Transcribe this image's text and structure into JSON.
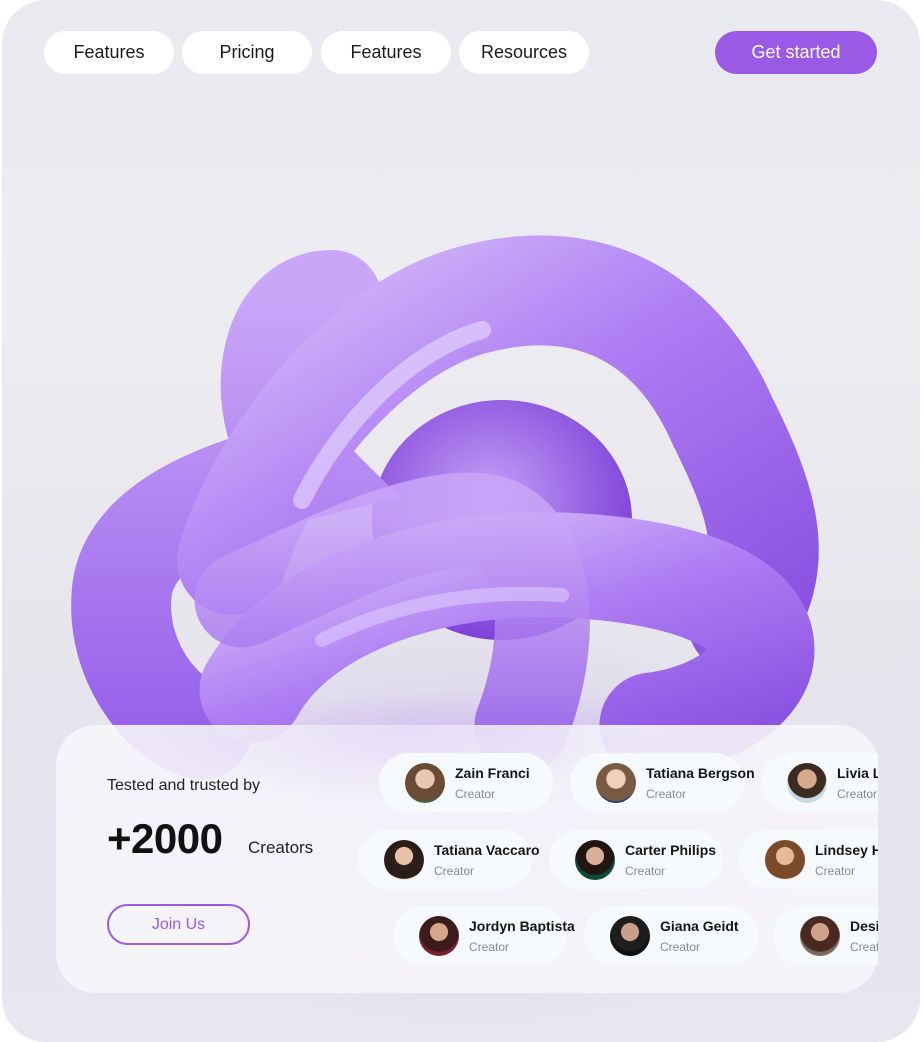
{
  "nav": {
    "items": [
      {
        "label": "Features"
      },
      {
        "label": "Pricing"
      },
      {
        "label": "Features"
      },
      {
        "label": "Resources"
      }
    ],
    "cta_label": "Get started"
  },
  "hero": {
    "tested_text": "Tested and trusted by",
    "count": "+2000",
    "count_suffix": "Creators",
    "join_label": "Join Us"
  },
  "creators": {
    "rows": [
      [
        {
          "name": "Zain Franci",
          "role": "Creator"
        },
        {
          "name": "Tatiana Bergson",
          "role": "Creator"
        },
        {
          "name": "Livia Lipshutz",
          "role": "Creator"
        }
      ],
      [
        {
          "name": "Tatiana Vaccaro",
          "role": "Creator"
        },
        {
          "name": "Carter Philips",
          "role": "Creator"
        },
        {
          "name": "Lindsey Herwitz",
          "role": "Creator"
        }
      ],
      [
        {
          "name": "Jordyn Baptista",
          "role": "Creator"
        },
        {
          "name": "Giana Geidt",
          "role": "Creator"
        },
        {
          "name": "Desirae",
          "role": "Creator"
        }
      ]
    ]
  },
  "colors": {
    "accent": "#9a5ae6",
    "knot": "#a774f0"
  }
}
